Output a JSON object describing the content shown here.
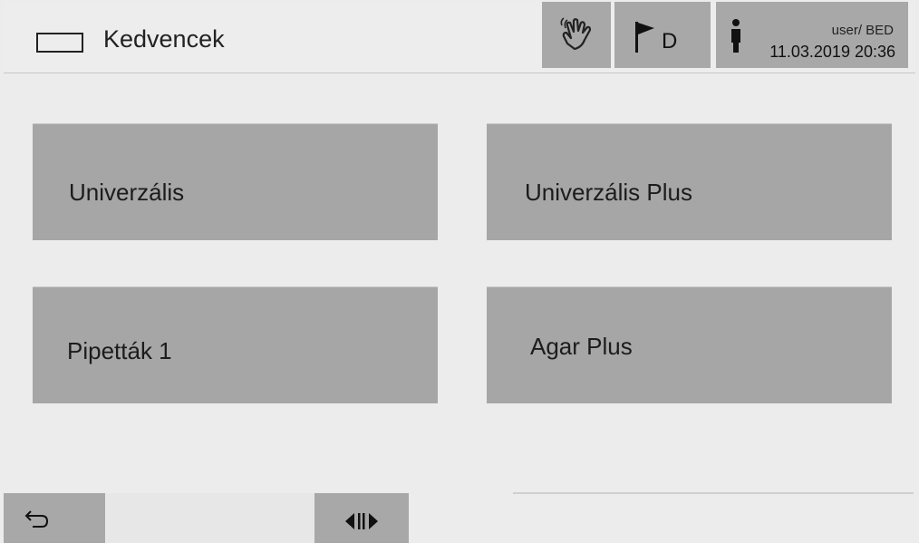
{
  "header": {
    "title": "Kedvencek",
    "language_code": "D",
    "user_label": "user/ BED",
    "datetime": "11.03.2019 20:36",
    "icons": [
      "hand-touch-icon",
      "flag-icon",
      "person-icon"
    ]
  },
  "favorites": [
    {
      "label": "Univerzális"
    },
    {
      "label": "Univerzális Plus"
    },
    {
      "label": "Pipetták 1"
    },
    {
      "label": "Agar Plus"
    }
  ],
  "footer": {
    "icons": [
      "back-arrow-icon",
      "split-view-icon"
    ]
  },
  "colors": {
    "background": "#ececec",
    "button_gray": "#a8a8a8",
    "tile_gray": "#a6a6a6",
    "text": "#222222"
  }
}
